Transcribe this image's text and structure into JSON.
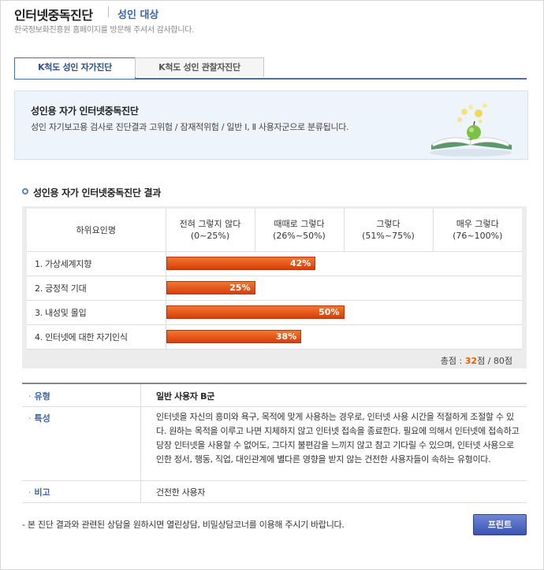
{
  "header": {
    "title": "인터넷중독진단",
    "subtitle": "성인 대상",
    "description": "한국정보화진흥원 홈페이지를 방문해 주셔서 감사합니다."
  },
  "tabs": [
    {
      "label": "K척도 성인 자가진단",
      "active": true
    },
    {
      "label": "K척도 성인 관찰자진단",
      "active": false
    }
  ],
  "intro": {
    "title": "성인용 자가 인터넷중독진단",
    "text": "성인 자기보고용 검사로 진단결과 고위험 / 잠재적위험 / 일반 Ⅰ, Ⅱ 사용자군으로 분류됩니다."
  },
  "result": {
    "section_title": "성인용 자가 인터넷중독진단 결과",
    "columns": {
      "factor": "하위요인명",
      "levels": [
        {
          "label": "전혀 그렇지 않다",
          "range": "(0~25%)"
        },
        {
          "label": "때때로 그렇다",
          "range": "(26%~50%)"
        },
        {
          "label": "그렇다",
          "range": "(51%~75%)"
        },
        {
          "label": "매우 그렇다",
          "range": "(76~100%)"
        }
      ]
    },
    "rows": [
      {
        "name": "1. 가상세계지향",
        "percent": 42,
        "label": "42%"
      },
      {
        "name": "2. 긍정적 기대",
        "percent": 25,
        "label": "25%"
      },
      {
        "name": "3. 내성및 몰입",
        "percent": 50,
        "label": "50%"
      },
      {
        "name": "4. 인터넷에 대한 자기인식",
        "percent": 38,
        "label": "38%"
      }
    ],
    "total_label": "총점 :",
    "total_score": "32",
    "total_suffix": "점 / 80점"
  },
  "info": {
    "type_label": "유형",
    "type_value": "일반 사용자 B군",
    "trait_label": "특성",
    "trait_value": "인터넷을 자신의 흥미와 욕구, 목적에 맞게 사용하는 경우로, 인터넷 사용 시간을 적절하게 조절할 수 있다. 원하는 목적을 이루고 나면 지체하지 않고 인터넷 접속을 종료한다. 필요에 의해서 인터넷에 접속하고 당장 인터넷을 사용할 수 없어도, 그다지 불편감을 느끼지 않고 참고 기다릴 수 있으며, 인터넷 사용으로 인한 정서, 행동, 직업, 대인관계에 별다른 영향을 받지 않는 건전한 사용자들이 속하는 유형이다.",
    "note_label": "비고",
    "note_value": "건전한 사용자"
  },
  "footnote": "- 본 진단 결과와 관련된 상담을 원하시면 열린상담, 비밀상담코너를 이용해 주시기 바랍니다.",
  "print_label": "프린트",
  "colors": {
    "bar": "#e8561b",
    "accent": "#3a63b0",
    "score": "#e06000"
  }
}
